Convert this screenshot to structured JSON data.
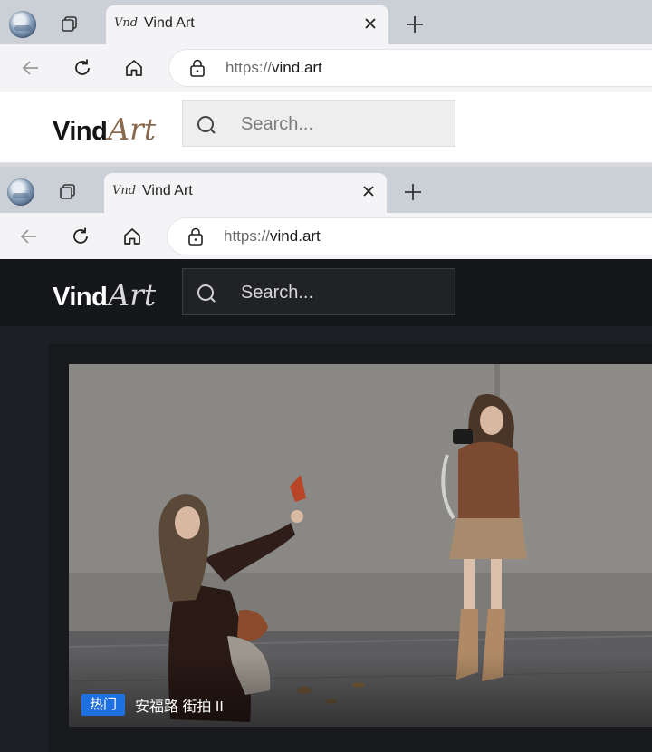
{
  "browser": {
    "tab_title": "Vind Art",
    "favicon_text": "Vnd",
    "url_scheme": "https://",
    "url_host": "vind.art",
    "icons": [
      "profile-avatar",
      "tabs-icon",
      "close-icon",
      "new-tab-icon",
      "back-icon",
      "reload-icon",
      "home-icon",
      "lock-icon"
    ]
  },
  "site": {
    "logo_vind": "Vind",
    "logo_art": "Art",
    "search_placeholder": "Search..."
  },
  "featured": {
    "badge": "热门",
    "title": "安福路 街拍 II"
  },
  "colors": {
    "dark_header": "#16171b",
    "dark_body": "#1e1f24",
    "badge_blue": "#1e6fe0",
    "logo_art_light": "#8a6a4f"
  }
}
